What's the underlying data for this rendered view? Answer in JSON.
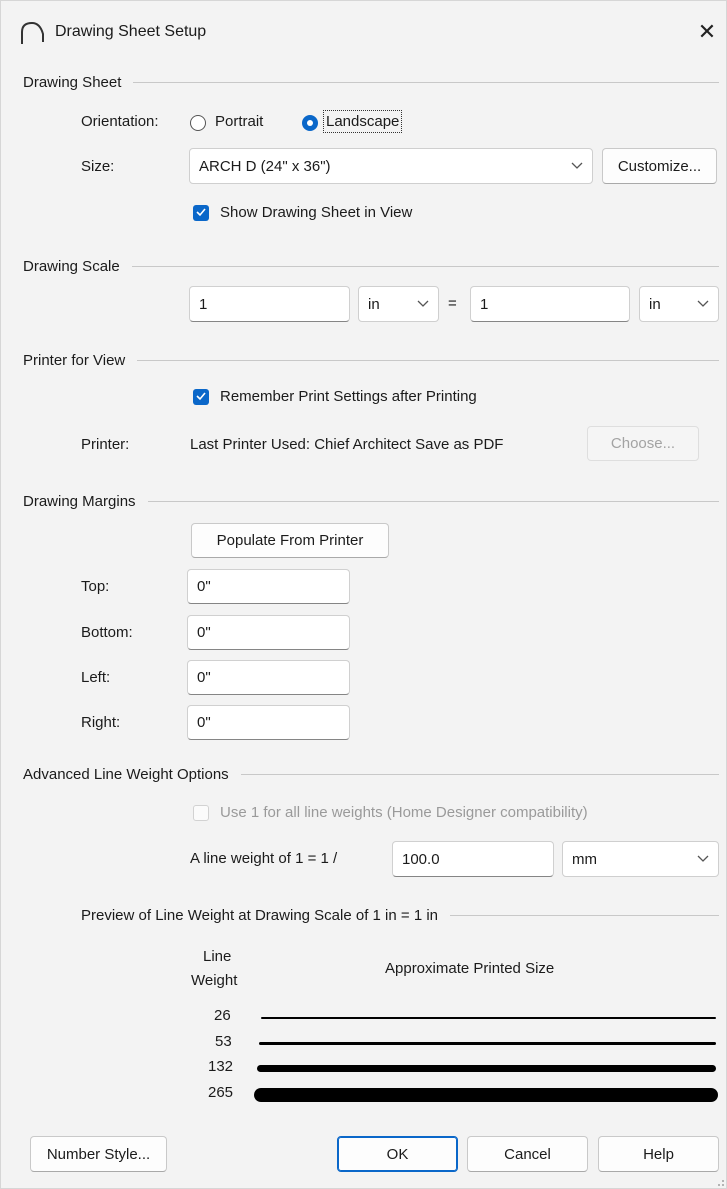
{
  "window": {
    "title": "Drawing Sheet Setup",
    "close_glyph": "✕",
    "icon": "chief-architect-arch-icon"
  },
  "drawing_sheet": {
    "heading": "Drawing Sheet",
    "orientation_label": "Orientation:",
    "portrait_label": "Portrait",
    "landscape_label": "Landscape",
    "orientation_selected": "Landscape",
    "size_label": "Size:",
    "size_value": "ARCH D  (24\" x 36\")",
    "customize_label": "Customize...",
    "show_sheet_label": "Show Drawing Sheet in View",
    "show_sheet_checked": true
  },
  "drawing_scale": {
    "heading": "Drawing Scale",
    "left_value": "1",
    "left_unit": "in",
    "equals": "=",
    "right_value": "1",
    "right_unit": "in"
  },
  "printer": {
    "heading": "Printer for View",
    "remember_label": "Remember Print Settings after Printing",
    "remember_checked": true,
    "printer_label": "Printer:",
    "printer_value": "Last Printer Used: Chief Architect Save as PDF",
    "choose_label": "Choose..."
  },
  "margins": {
    "heading": "Drawing Margins",
    "populate_label": "Populate From Printer",
    "top_label": "Top:",
    "top_value": "0\"",
    "bottom_label": "Bottom:",
    "bottom_value": "0\"",
    "left_label": "Left:",
    "left_value": "0\"",
    "right_label": "Right:",
    "right_value": "0\""
  },
  "line_weight": {
    "heading": "Advanced Line Weight Options",
    "use1_label": "Use 1 for all line weights (Home Designer compatibility)",
    "use1_checked": false,
    "ratio_label": "A line weight of 1 = 1 /",
    "ratio_value": "100.0",
    "ratio_unit": "mm",
    "preview_heading": "Preview of Line Weight at Drawing Scale of  1 in = 1 in",
    "col_line": "Line",
    "col_weight": "Weight",
    "col_size": "Approximate Printed Size",
    "rows": [
      {
        "weight": "26"
      },
      {
        "weight": "53"
      },
      {
        "weight": "132"
      },
      {
        "weight": "265"
      }
    ]
  },
  "footer": {
    "number_style_label": "Number Style...",
    "ok_label": "OK",
    "cancel_label": "Cancel",
    "help_label": "Help"
  },
  "colors": {
    "accent": "#0a67c9",
    "background": "#f3f3f3"
  }
}
